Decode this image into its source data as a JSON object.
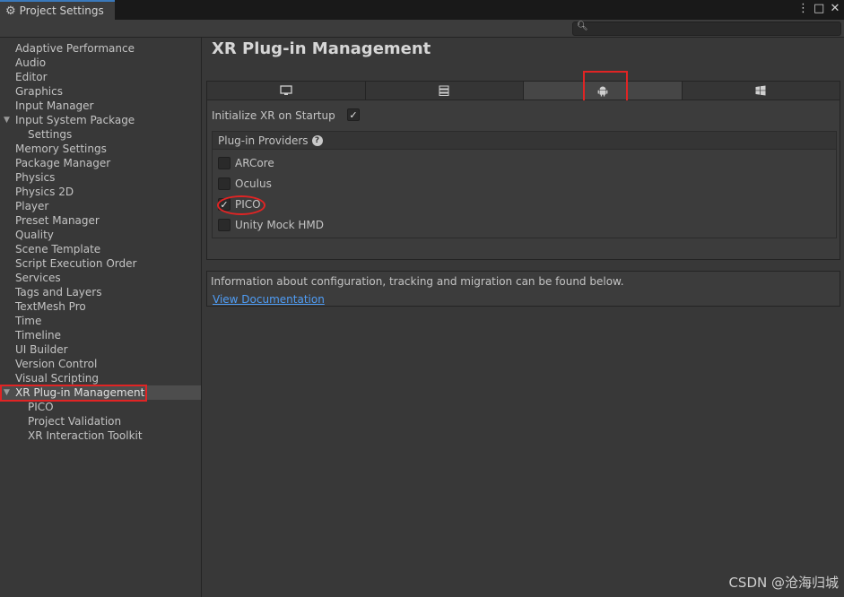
{
  "window": {
    "tab_title": "Project Settings",
    "icons": {
      "tab": "gear-icon",
      "more": "kebab-menu-icon",
      "maximize": "maximize-icon",
      "close": "close-icon"
    }
  },
  "toolbar": {
    "search_placeholder": ""
  },
  "sidebar": {
    "items": [
      {
        "label": "Adaptive Performance"
      },
      {
        "label": "Audio"
      },
      {
        "label": "Editor"
      },
      {
        "label": "Graphics"
      },
      {
        "label": "Input Manager"
      },
      {
        "label": "Input System Package"
      },
      {
        "label": "Settings"
      },
      {
        "label": "Memory Settings"
      },
      {
        "label": "Package Manager"
      },
      {
        "label": "Physics"
      },
      {
        "label": "Physics 2D"
      },
      {
        "label": "Player"
      },
      {
        "label": "Preset Manager"
      },
      {
        "label": "Quality"
      },
      {
        "label": "Scene Template"
      },
      {
        "label": "Script Execution Order"
      },
      {
        "label": "Services"
      },
      {
        "label": "Tags and Layers"
      },
      {
        "label": "TextMesh Pro"
      },
      {
        "label": "Time"
      },
      {
        "label": "Timeline"
      },
      {
        "label": "UI Builder"
      },
      {
        "label": "Version Control"
      },
      {
        "label": "Visual Scripting"
      },
      {
        "label": "XR Plug-in Management"
      },
      {
        "label": "PICO"
      },
      {
        "label": "Project Validation"
      },
      {
        "label": "XR Interaction Toolkit"
      }
    ],
    "selected": "XR Plug-in Management"
  },
  "main": {
    "title": "XR Plug-in Management",
    "platform_tabs": [
      {
        "icon": "desktop-icon",
        "active": false
      },
      {
        "icon": "server-icon",
        "active": false
      },
      {
        "icon": "android-icon",
        "active": true
      },
      {
        "icon": "windows-icon",
        "active": false
      }
    ],
    "initialize_label": "Initialize XR on Startup",
    "initialize_checked": true,
    "providers_header": "Plug-in Providers",
    "providers": [
      {
        "label": "ARCore",
        "checked": false
      },
      {
        "label": "Oculus",
        "checked": false
      },
      {
        "label": "PICO",
        "checked": true
      },
      {
        "label": "Unity Mock HMD",
        "checked": false
      }
    ],
    "info_text": "Information about configuration, tracking and migration can be found below.",
    "info_link": "View Documentation"
  },
  "colors": {
    "annotation": "#e02424",
    "link": "#4f9df6",
    "tab_accent": "#3a79bb"
  },
  "watermark": "CSDN @沧海归城"
}
